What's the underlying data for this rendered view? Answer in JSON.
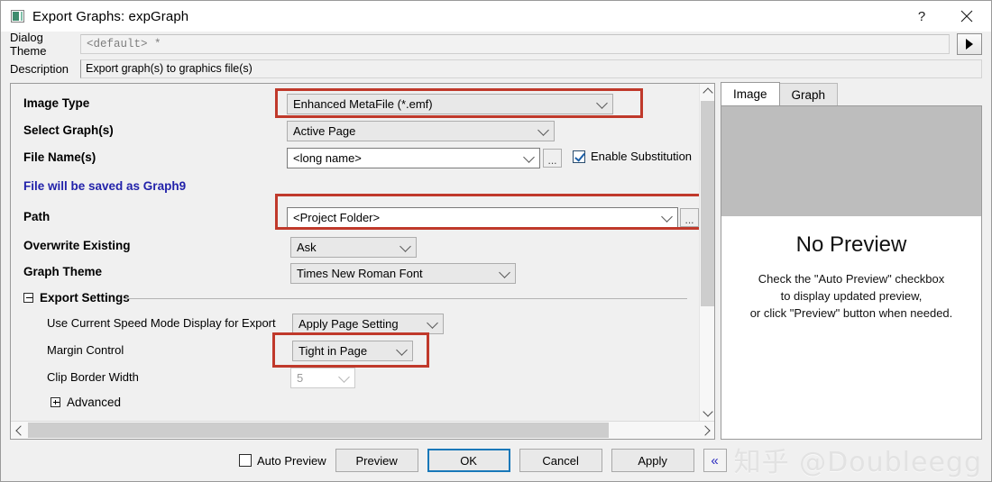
{
  "window": {
    "title": "Export Graphs: expGraph",
    "icon": "graph-window-icon",
    "help_label": "?",
    "close_label": "✕"
  },
  "theme_row": {
    "label": "Dialog Theme",
    "value": "<default> *",
    "arrow_icon": "play-arrow-icon"
  },
  "description_row": {
    "label": "Description",
    "value": "Export graph(s) to graphics file(s)"
  },
  "form": {
    "image_type": {
      "label": "Image Type",
      "value": "Enhanced MetaFile (*.emf)"
    },
    "select_graphs": {
      "label": "Select Graph(s)",
      "value": "Active Page"
    },
    "file_names": {
      "label": "File Name(s)",
      "value": "<long name>",
      "browse_label": "...",
      "substitution_label": "Enable Substitution",
      "substitution_checked": true
    },
    "save_note": "File will be saved as Graph9",
    "path": {
      "label": "Path",
      "value": "<Project Folder>",
      "browse_label": "..."
    },
    "overwrite": {
      "label": "Overwrite Existing",
      "value": "Ask"
    },
    "graph_theme": {
      "label": "Graph Theme",
      "value": "Times New Roman Font"
    },
    "export_settings": {
      "title": "Export Settings",
      "speed_mode": {
        "label": "Use Current Speed Mode Display for Export",
        "value": "Apply Page Setting"
      },
      "margin_control": {
        "label": "Margin Control",
        "value": "Tight in Page"
      },
      "clip_border": {
        "label": "Clip Border Width",
        "value": "5"
      },
      "advanced": {
        "label": "Advanced"
      }
    }
  },
  "preview": {
    "tabs": [
      {
        "label": "Image",
        "active": true
      },
      {
        "label": "Graph",
        "active": false
      }
    ],
    "title": "No Preview",
    "line1": "Check the \"Auto Preview\" checkbox",
    "line2": "to display updated preview,",
    "line3": "or click \"Preview\" button when needed."
  },
  "footer": {
    "auto_preview_label": "Auto Preview",
    "auto_preview_checked": false,
    "preview_label": "Preview",
    "ok_label": "OK",
    "cancel_label": "Cancel",
    "apply_label": "Apply",
    "collapse_label": "«"
  },
  "watermark": "知乎 @Doubleegg",
  "colors": {
    "highlight": "#c0392b",
    "focus": "#1878b9",
    "note": "#2222aa"
  }
}
